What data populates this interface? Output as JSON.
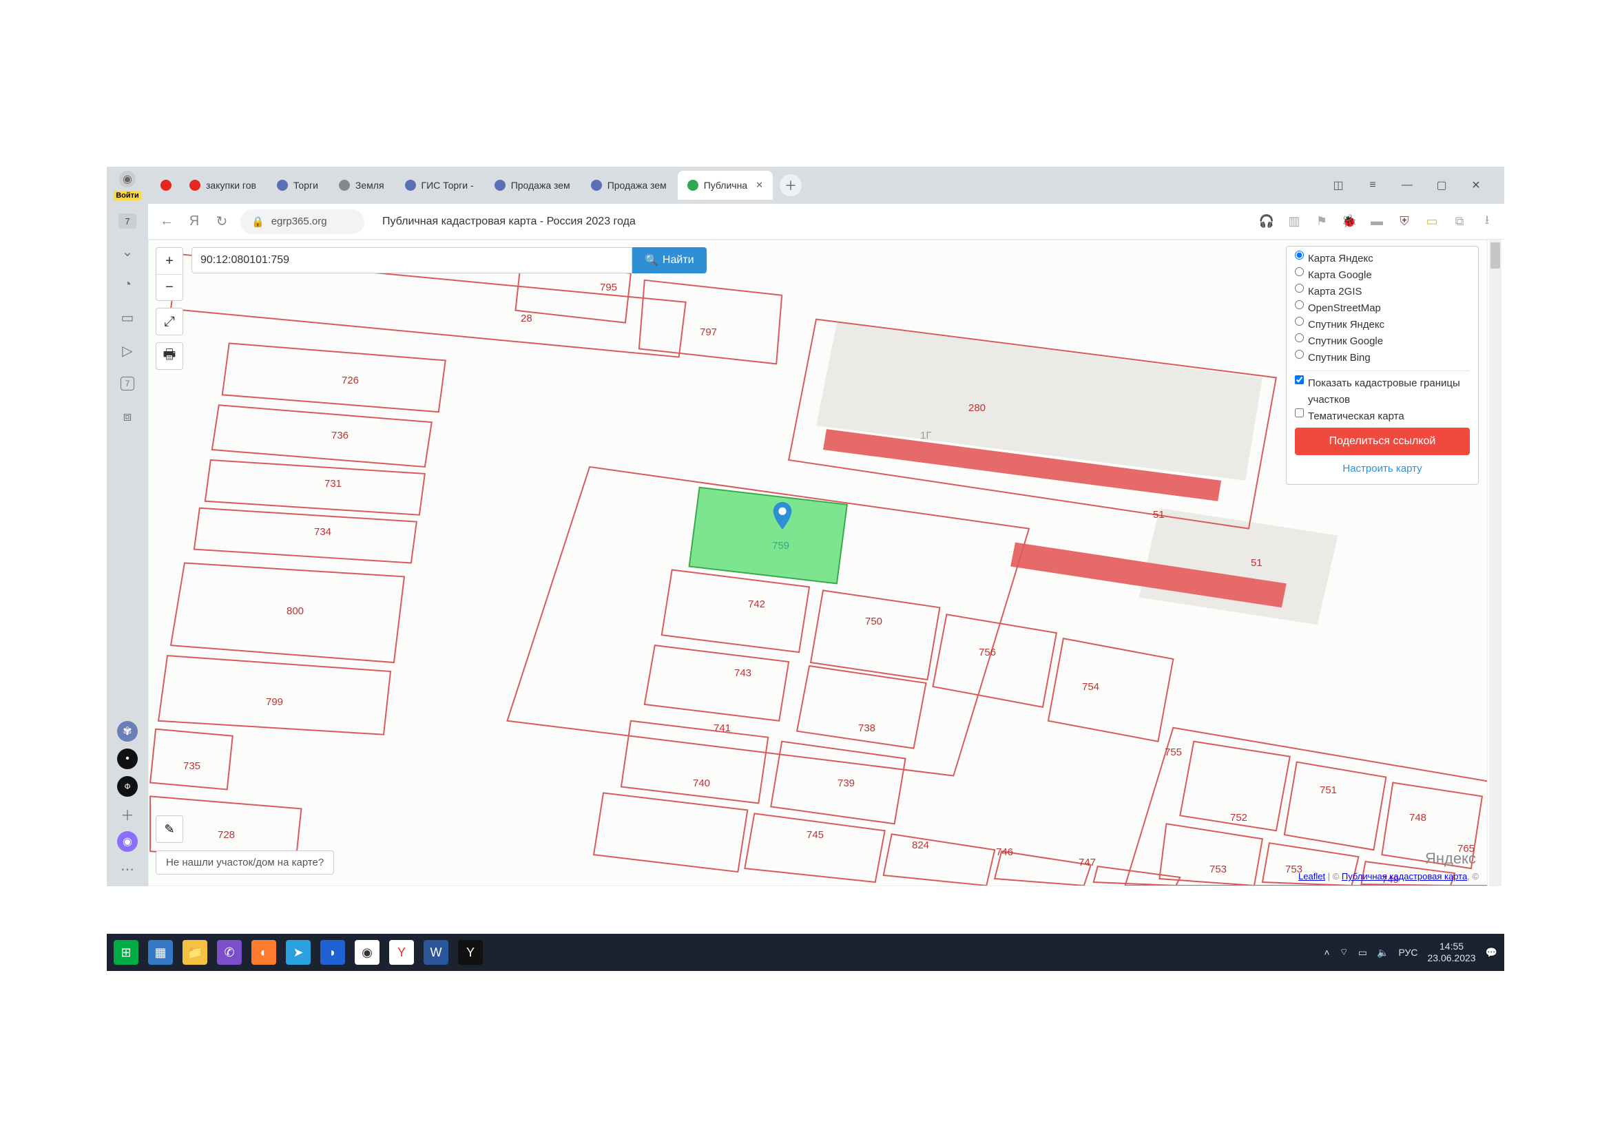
{
  "sidebar": {
    "login_label": "Войти",
    "counter": "7",
    "box_label": "7"
  },
  "tabs": [
    {
      "label": "закупки гов",
      "fav": "#e52620"
    },
    {
      "label": "Торги",
      "fav": "#5b6fb5"
    },
    {
      "label": "Земля",
      "fav": "#888"
    },
    {
      "label": "ГИС Торги -",
      "fav": "#5b6fb5"
    },
    {
      "label": "Продажа зем",
      "fav": "#5b6fb5"
    },
    {
      "label": "Продажа зем",
      "fav": "#5b6fb5"
    },
    {
      "label": "Публична",
      "fav": "#2fa84f",
      "active": true
    }
  ],
  "address": {
    "domain": "egrp365.org",
    "title": "Публичная кадастровая карта - Россия 2023 года"
  },
  "search": {
    "value": "90:12:080101:759",
    "button": "Найти"
  },
  "layers": {
    "options": [
      "Карта Яндекс",
      "Карта Google",
      "Карта 2GIS",
      "OpenStreetMap",
      "Спутник Яндекс",
      "Спутник Google",
      "Спутник Bing"
    ],
    "selected": 0,
    "cb_boundaries": "Показать кадастровые границы участков",
    "cb_thematic": "Тематическая карта",
    "share": "Поделиться ссылкой",
    "configure": "Настроить карту"
  },
  "parcels": [
    "795",
    "797",
    "28",
    "726",
    "736",
    "731",
    "734",
    "800",
    "799",
    "735",
    "728",
    "280",
    "1Г",
    "51",
    "51",
    "742",
    "750",
    "756",
    "754",
    "743",
    "741",
    "738",
    "740",
    "739",
    "745",
    "824",
    "746",
    "747",
    "755",
    "752",
    "751",
    "748",
    "753",
    "753",
    "749",
    "765"
  ],
  "selected_parcel": "759",
  "help_chip": "Не нашли участок/дом на карте?",
  "attribution": {
    "leaflet": "Leaflet",
    "src": "Публичная кадастровая карта",
    "logo": "Яндекс"
  },
  "tray": {
    "lang": "РУС",
    "time": "14:55",
    "date": "23.06.2023"
  }
}
